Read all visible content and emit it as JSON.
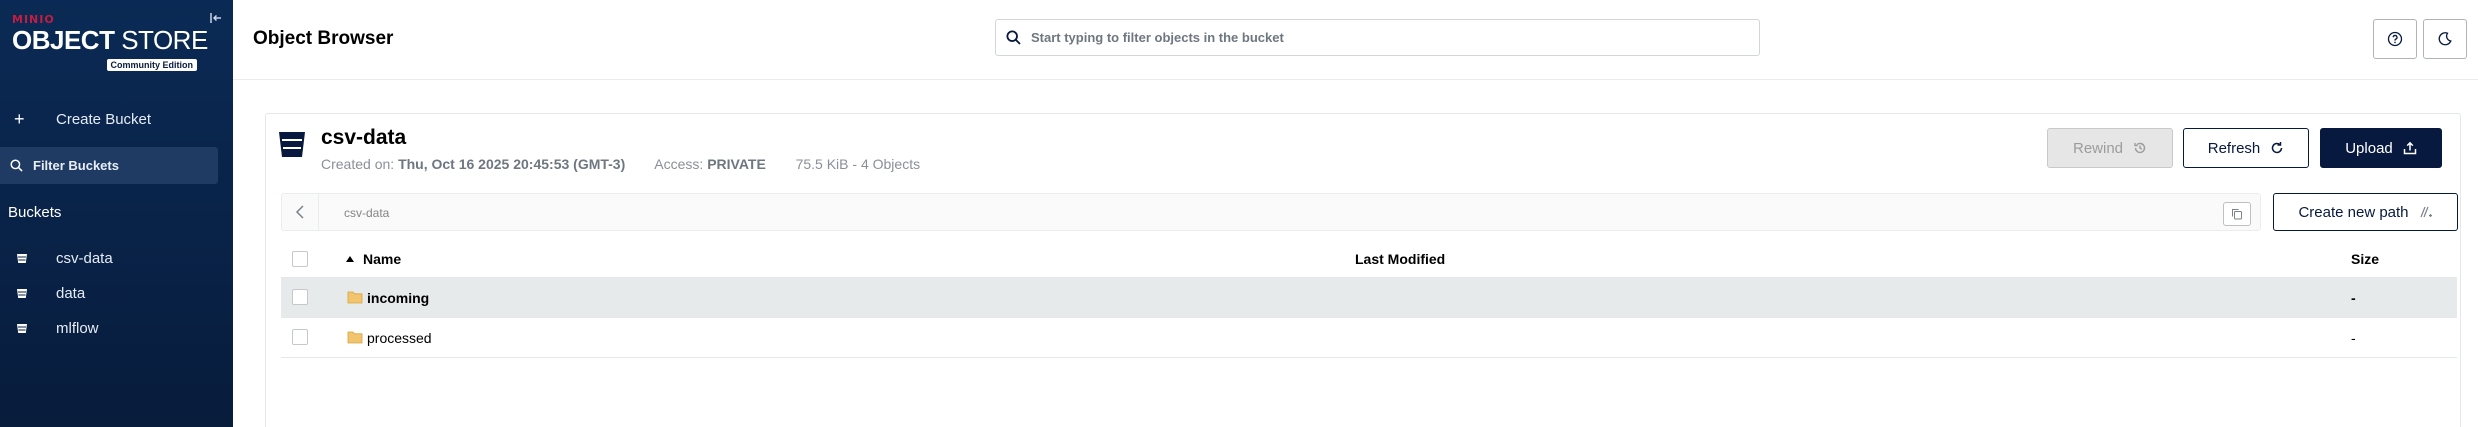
{
  "sidebar": {
    "logo": {
      "brand": "MINIO",
      "product_bold": "OBJECT",
      "product_thin": " STORE",
      "edition": "Community Edition"
    },
    "create_bucket_label": "Create Bucket",
    "filter_placeholder": "Filter Buckets",
    "buckets_heading": "Buckets",
    "buckets": [
      {
        "label": "csv-data"
      },
      {
        "label": "data"
      },
      {
        "label": "mlflow"
      }
    ]
  },
  "header": {
    "title": "Object Browser",
    "search_placeholder": "Start typing to filter objects in the bucket"
  },
  "bucket": {
    "name": "csv-data",
    "created_label": "Created on: ",
    "created_value": "Thu, Oct 16 2025 20:45:53 (GMT-3)",
    "access_label": "Access: ",
    "access_value": "PRIVATE",
    "usage": "75.5 KiB - 4 Objects"
  },
  "actions": {
    "rewind_label": "Rewind",
    "refresh_label": "Refresh",
    "upload_label": "Upload",
    "create_path_label": "Create new path"
  },
  "path": {
    "current": "csv-data"
  },
  "table": {
    "columns": {
      "name": "Name",
      "last_modified": "Last Modified",
      "size": "Size"
    },
    "rows": [
      {
        "name": "incoming",
        "last_modified": "",
        "size": "-",
        "selected": true
      },
      {
        "name": "processed",
        "last_modified": "",
        "size": "-",
        "selected": false
      }
    ]
  },
  "colors": {
    "sidebar_bg": "#081c3c",
    "primary": "#07193e",
    "brand_red": "#c51c3f",
    "selected_row": "#e6eaeb"
  }
}
